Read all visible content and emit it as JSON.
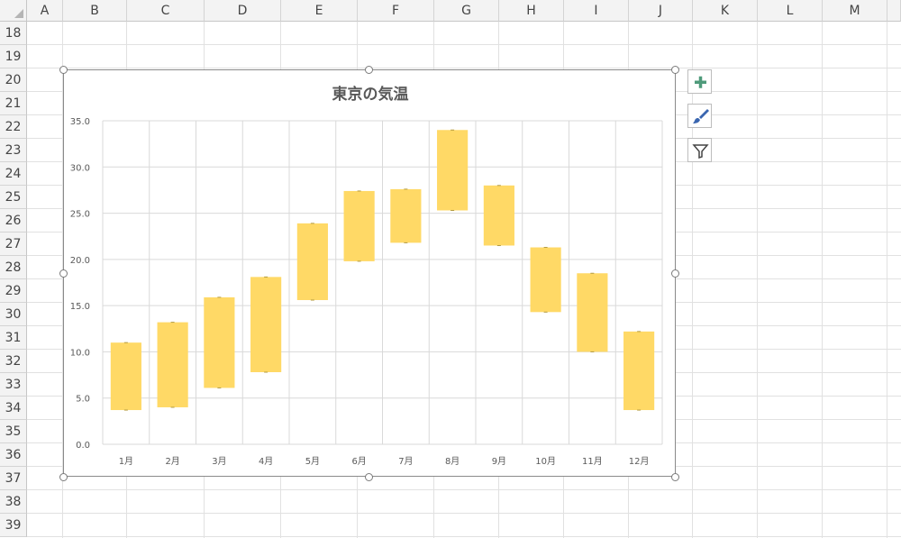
{
  "sheet": {
    "columns": [
      "A",
      "B",
      "C",
      "D",
      "E",
      "F",
      "G",
      "H",
      "I",
      "J",
      "K",
      "L",
      "M"
    ],
    "rows": [
      "18",
      "19",
      "20",
      "21",
      "22",
      "23",
      "24",
      "25",
      "26",
      "27",
      "28",
      "29",
      "30",
      "31",
      "32",
      "33",
      "34",
      "35",
      "36",
      "37",
      "38",
      "39"
    ]
  },
  "chart_tools": {
    "add_element_icon": "plus-icon",
    "style_icon": "brush-icon",
    "filter_icon": "filter-icon",
    "plus_color": "#4e9a7a",
    "brush_color": "#3a66b0"
  },
  "chart_data": {
    "type": "bar",
    "subtype": "floating",
    "title": "東京の気温",
    "categories": [
      "1月",
      "2月",
      "3月",
      "4月",
      "5月",
      "6月",
      "7月",
      "8月",
      "9月",
      "10月",
      "11月",
      "12月"
    ],
    "series": [
      {
        "low": [
          3.7,
          4.0,
          6.1,
          7.8,
          15.6,
          19.8,
          21.8,
          25.3,
          21.5,
          14.3,
          10.0,
          3.7
        ],
        "high": [
          11.0,
          13.2,
          15.9,
          18.1,
          23.9,
          27.4,
          27.6,
          34.0,
          28.0,
          21.3,
          18.5,
          12.2
        ],
        "color": "#ffd966"
      }
    ],
    "ylim": [
      0,
      35
    ],
    "yticks": [
      "0.0",
      "5.0",
      "10.0",
      "15.0",
      "20.0",
      "25.0",
      "30.0",
      "35.0"
    ],
    "xlabel": "",
    "ylabel": "",
    "grid": true,
    "legend": "none",
    "colors": {
      "bar": "#ffd966",
      "grid": "#d9d9d9",
      "text": "#595959"
    }
  }
}
